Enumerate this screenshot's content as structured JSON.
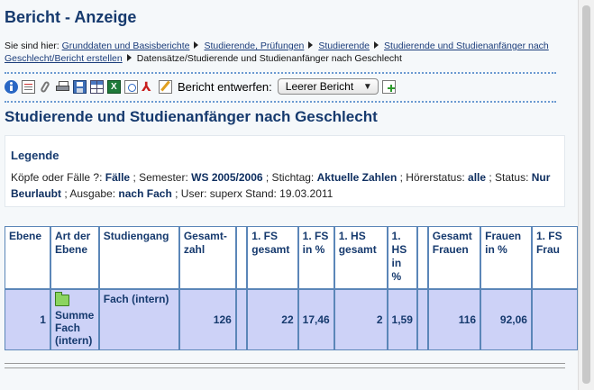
{
  "page": {
    "title": "Bericht - Anzeige",
    "breadcrumb": {
      "prefix": "Sie sind hier:",
      "items": [
        "Grunddaten und Basisberichte",
        "Studierende, Prüfungen",
        "Studierende",
        "Studierende und Studienanfänger nach Geschlecht/Bericht erstellen"
      ],
      "current": "Datensätze/Studierende und Studienanfänger nach Geschlecht"
    },
    "toolbar": {
      "icons": [
        "info-icon",
        "document-icon",
        "paperclip-icon",
        "print-icon",
        "save-icon",
        "table-icon",
        "excel-icon",
        "export-icon",
        "pdf-icon",
        "edit-icon"
      ],
      "report_label": "Bericht entwerfen:",
      "report_select_value": "Leerer Bericht",
      "add_icon": "new-report-icon"
    },
    "heading": "Studierende und Studienanfänger nach Geschlecht",
    "legend": {
      "title": "Legende",
      "line": [
        {
          "label": "Köpfe oder Fälle ?:",
          "value": "Fälle"
        },
        {
          "label": "; Semester:",
          "value": "WS 2005/2006"
        },
        {
          "label": "; Stichtag:",
          "value": "Aktuelle Zahlen"
        },
        {
          "label": "; Hörerstatus:",
          "value": "alle"
        },
        {
          "label": "; Status:",
          "value": "Nur Beurlaubt"
        },
        {
          "label": "; Ausgabe:",
          "value": "nach Fach"
        }
      ],
      "tail": "; User: superx  Stand: 19.03.2011"
    }
  },
  "table": {
    "headers": [
      "Ebene",
      "Art der Ebene",
      "Studiengang",
      "Gesamt-zahl",
      "",
      "1. FS gesamt",
      "1. FS in %",
      "1. HS gesamt",
      "1. HS in %",
      "",
      "Gesamt Frauen",
      "Frauen in %",
      "1. FS Frau"
    ],
    "rows": [
      {
        "ebene": "1",
        "art": "Summe Fach (intern)",
        "studiengang": "Fach (intern)",
        "gesamtzahl": "126",
        "blank1": "",
        "fs_gesamt": "22",
        "fs_pct": "17,46",
        "hs_gesamt": "2",
        "hs_pct": "1,59",
        "blank2": "",
        "frauen": "116",
        "frauen_pct": "92,06",
        "fs_frauen": ""
      }
    ]
  }
}
